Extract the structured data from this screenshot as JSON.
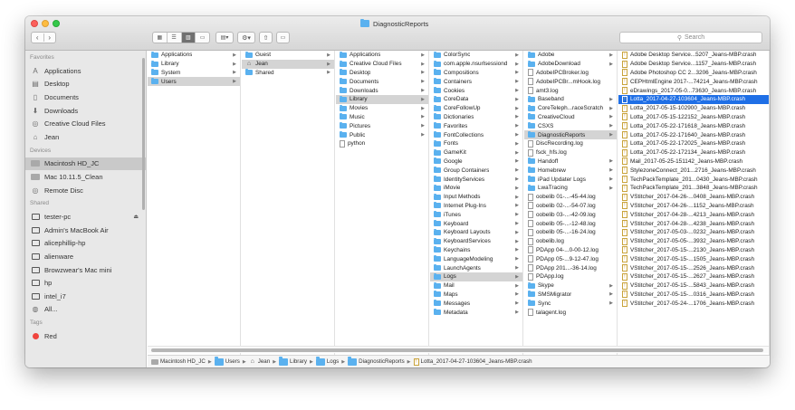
{
  "window": {
    "title": "DiagnosticReports"
  },
  "toolbar": {
    "back": "‹",
    "forward": "›",
    "search_placeholder": "Search",
    "views": [
      "icon-view",
      "list-view",
      "column-view",
      "cover-flow-view"
    ]
  },
  "sidebar": {
    "favorites_header": "Favorites",
    "favorites": [
      {
        "label": "Applications",
        "icon": "applications-icon"
      },
      {
        "label": "Desktop",
        "icon": "desktop-icon"
      },
      {
        "label": "Documents",
        "icon": "documents-icon"
      },
      {
        "label": "Downloads",
        "icon": "downloads-icon"
      },
      {
        "label": "Creative Cloud Files",
        "icon": "creative-cloud-icon"
      },
      {
        "label": "Jean",
        "icon": "home-icon"
      }
    ],
    "devices_header": "Devices",
    "devices": [
      {
        "label": "Macintosh HD_JC",
        "selected": true
      },
      {
        "label": "Mac 10.11.5_Clean"
      },
      {
        "label": "Remote Disc"
      }
    ],
    "shared_header": "Shared",
    "shared": [
      {
        "label": "tester-pc",
        "eject": "⏏"
      },
      {
        "label": "Admin's MacBook Air"
      },
      {
        "label": "alicephillip-hp"
      },
      {
        "label": "alienware"
      },
      {
        "label": "Browzwear's Mac mini"
      },
      {
        "label": "hp"
      },
      {
        "label": "intel_i7"
      },
      {
        "label": "All..."
      }
    ],
    "tags_header": "Tags",
    "tags": [
      {
        "label": "Red",
        "color": "#f0443d"
      }
    ]
  },
  "columns": [
    [
      {
        "label": "Applications",
        "icon": "folder",
        "arrow": true
      },
      {
        "label": "Library",
        "icon": "folder",
        "arrow": true
      },
      {
        "label": "System",
        "icon": "folder",
        "arrow": true
      },
      {
        "label": "Users",
        "icon": "folder",
        "arrow": true,
        "state": "hl"
      }
    ],
    [
      {
        "label": "Guest",
        "icon": "folder",
        "arrow": true
      },
      {
        "label": "Jean",
        "icon": "home",
        "arrow": true,
        "state": "hl"
      },
      {
        "label": "Shared",
        "icon": "folder",
        "arrow": true
      }
    ],
    [
      {
        "label": "Applications",
        "icon": "folder",
        "arrow": true
      },
      {
        "label": "Creative Cloud Files",
        "icon": "folder",
        "arrow": true
      },
      {
        "label": "Desktop",
        "icon": "folder",
        "arrow": true
      },
      {
        "label": "Documents",
        "icon": "folder",
        "arrow": true
      },
      {
        "label": "Downloads",
        "icon": "folder",
        "arrow": true
      },
      {
        "label": "Library",
        "icon": "folder",
        "arrow": true,
        "state": "hl"
      },
      {
        "label": "Movies",
        "icon": "folder",
        "arrow": true
      },
      {
        "label": "Music",
        "icon": "folder",
        "arrow": true
      },
      {
        "label": "Pictures",
        "icon": "folder",
        "arrow": true
      },
      {
        "label": "Public",
        "icon": "folder",
        "arrow": true
      },
      {
        "label": "python",
        "icon": "doc",
        "arrow": false
      }
    ],
    [
      {
        "label": "ColorSync",
        "icon": "folder",
        "arrow": true
      },
      {
        "label": "com.apple.nsurlsessiond",
        "icon": "folder",
        "arrow": true
      },
      {
        "label": "Compositions",
        "icon": "folder",
        "arrow": true
      },
      {
        "label": "Containers",
        "icon": "folder",
        "arrow": true
      },
      {
        "label": "Cookies",
        "icon": "folder",
        "arrow": true
      },
      {
        "label": "CoreData",
        "icon": "folder",
        "arrow": true
      },
      {
        "label": "CoreFollowUp",
        "icon": "folder",
        "arrow": true
      },
      {
        "label": "Dictionaries",
        "icon": "folder",
        "arrow": true
      },
      {
        "label": "Favorites",
        "icon": "folder",
        "arrow": true
      },
      {
        "label": "FontCollections",
        "icon": "folder",
        "arrow": true
      },
      {
        "label": "Fonts",
        "icon": "folder",
        "arrow": true
      },
      {
        "label": "GameKit",
        "icon": "folder",
        "arrow": true
      },
      {
        "label": "Google",
        "icon": "folder",
        "arrow": true
      },
      {
        "label": "Group Containers",
        "icon": "folder",
        "arrow": true
      },
      {
        "label": "IdentityServices",
        "icon": "folder",
        "arrow": true
      },
      {
        "label": "iMovie",
        "icon": "folder",
        "arrow": true
      },
      {
        "label": "Input Methods",
        "icon": "folder",
        "arrow": true
      },
      {
        "label": "Internet Plug-Ins",
        "icon": "folder",
        "arrow": true
      },
      {
        "label": "iTunes",
        "icon": "folder",
        "arrow": true
      },
      {
        "label": "Keyboard",
        "icon": "folder",
        "arrow": true
      },
      {
        "label": "Keyboard Layouts",
        "icon": "folder",
        "arrow": true
      },
      {
        "label": "KeyboardServices",
        "icon": "folder",
        "arrow": true
      },
      {
        "label": "Keychains",
        "icon": "folder",
        "arrow": true
      },
      {
        "label": "LanguageModeling",
        "icon": "folder",
        "arrow": true
      },
      {
        "label": "LaunchAgents",
        "icon": "folder",
        "arrow": true
      },
      {
        "label": "Logs",
        "icon": "folder",
        "arrow": true,
        "state": "hl"
      },
      {
        "label": "Mail",
        "icon": "folder",
        "arrow": true
      },
      {
        "label": "Maps",
        "icon": "folder",
        "arrow": true
      },
      {
        "label": "Messages",
        "icon": "folder",
        "arrow": true
      },
      {
        "label": "Metadata",
        "icon": "folder",
        "arrow": true
      }
    ],
    [
      {
        "label": "Adobe",
        "icon": "folder",
        "arrow": true
      },
      {
        "label": "AdobeDownload",
        "icon": "folder",
        "arrow": true
      },
      {
        "label": "AdobeIPCBroker.log",
        "icon": "doc",
        "arrow": false
      },
      {
        "label": "AdobeIPCBr...mHook.log",
        "icon": "doc",
        "arrow": false
      },
      {
        "label": "amt3.log",
        "icon": "doc",
        "arrow": false
      },
      {
        "label": "Baseband",
        "icon": "folder",
        "arrow": true
      },
      {
        "label": "CoreTeleph...raceScratch",
        "icon": "folder",
        "arrow": true
      },
      {
        "label": "CreativeCloud",
        "icon": "folder",
        "arrow": true
      },
      {
        "label": "CSXS",
        "icon": "folder",
        "arrow": true
      },
      {
        "label": "DiagnosticReports",
        "icon": "folder",
        "arrow": true,
        "state": "hl"
      },
      {
        "label": "DiscRecording.log",
        "icon": "doc",
        "arrow": false
      },
      {
        "label": "fsck_hfs.log",
        "icon": "doc",
        "arrow": false
      },
      {
        "label": "Handoff",
        "icon": "folder",
        "arrow": true
      },
      {
        "label": "Homebrew",
        "icon": "folder",
        "arrow": true
      },
      {
        "label": "iPad Updater Logs",
        "icon": "folder",
        "arrow": true
      },
      {
        "label": "LwaTracing",
        "icon": "folder",
        "arrow": true
      },
      {
        "label": "oobelib 01-...-45-44.log",
        "icon": "doc",
        "arrow": false
      },
      {
        "label": "oobelib 02-...-54-07.log",
        "icon": "doc",
        "arrow": false
      },
      {
        "label": "oobelib 03-...-42-09.log",
        "icon": "doc",
        "arrow": false
      },
      {
        "label": "oobelib 05-...-12-48.log",
        "icon": "doc",
        "arrow": false
      },
      {
        "label": "oobelib 05-...-16-24.log",
        "icon": "doc",
        "arrow": false
      },
      {
        "label": "oobelib.log",
        "icon": "doc",
        "arrow": false
      },
      {
        "label": "PDApp 04-...0-00-12.log",
        "icon": "doc",
        "arrow": false
      },
      {
        "label": "PDApp 05-...9-12-47.log",
        "icon": "doc",
        "arrow": false
      },
      {
        "label": "PDApp 201...-36-14.log",
        "icon": "doc",
        "arrow": false
      },
      {
        "label": "PDApp.log",
        "icon": "doc",
        "arrow": false
      },
      {
        "label": "Skype",
        "icon": "folder",
        "arrow": true
      },
      {
        "label": "SMSMigrator",
        "icon": "folder",
        "arrow": true
      },
      {
        "label": "Sync",
        "icon": "folder",
        "arrow": true
      },
      {
        "label": "talagent.log",
        "icon": "doc",
        "arrow": false
      }
    ],
    [
      {
        "label": "Adobe Desktop Service...5207_Jeans-MBP.crash",
        "icon": "crash"
      },
      {
        "label": "Adobe Desktop Service...1157_Jeans-MBP.crash",
        "icon": "crash"
      },
      {
        "label": "Adobe Photoshop CC 2...3206_Jeans-MBP.crash",
        "icon": "crash"
      },
      {
        "label": "CEPHtmlEngine 2017-...74214_Jeans-MBP.crash",
        "icon": "crash"
      },
      {
        "label": "eDrawings_2017-05-0...73630_Jeans-MBP.crash",
        "icon": "crash"
      },
      {
        "label": "Lotta_2017-04-27-103604_Jeans-MBP.crash",
        "icon": "crash",
        "state": "sel"
      },
      {
        "label": "Lotta_2017-05-15-102900_Jeans-MBP.crash",
        "icon": "crash"
      },
      {
        "label": "Lotta_2017-05-15-122152_Jeans-MBP.crash",
        "icon": "crash"
      },
      {
        "label": "Lotta_2017-05-22-171618_Jeans-MBP.crash",
        "icon": "crash"
      },
      {
        "label": "Lotta_2017-05-22-171640_Jeans-MBP.crash",
        "icon": "crash"
      },
      {
        "label": "Lotta_2017-05-22-172025_Jeans-MBP.crash",
        "icon": "crash"
      },
      {
        "label": "Lotta_2017-05-22-172134_Jeans-MBP.crash",
        "icon": "crash"
      },
      {
        "label": "Mail_2017-05-25-151142_Jeans-MBP.crash",
        "icon": "crash"
      },
      {
        "label": "StylezoneConnect_201...2716_Jeans-MBP.crash",
        "icon": "crash"
      },
      {
        "label": "TechPackTemplate_201...0430_Jeans-MBP.crash",
        "icon": "crash"
      },
      {
        "label": "TechPackTemplate_201...3848_Jeans-MBP.crash",
        "icon": "crash"
      },
      {
        "label": "VStitcher_2017-04-26-...0408_Jeans-MBP.crash",
        "icon": "crash"
      },
      {
        "label": "VStitcher_2017-04-26-...1152_Jeans-MBP.crash",
        "icon": "crash"
      },
      {
        "label": "VStitcher_2017-04-28-...4213_Jeans-MBP.crash",
        "icon": "crash"
      },
      {
        "label": "VStitcher_2017-04-28-...4238_Jeans-MBP.crash",
        "icon": "crash"
      },
      {
        "label": "VStitcher_2017-05-03-...0232_Jeans-MBP.crash",
        "icon": "crash"
      },
      {
        "label": "VStitcher_2017-05-05-...3932_Jeans-MBP.crash",
        "icon": "crash"
      },
      {
        "label": "VStitcher_2017-05-15-...2130_Jeans-MBP.crash",
        "icon": "crash"
      },
      {
        "label": "VStitcher_2017-05-15-...1505_Jeans-MBP.crash",
        "icon": "crash"
      },
      {
        "label": "VStitcher_2017-05-15-...2526_Jeans-MBP.crash",
        "icon": "crash"
      },
      {
        "label": "VStitcher_2017-05-15-...2627_Jeans-MBP.crash",
        "icon": "crash"
      },
      {
        "label": "VStitcher_2017-05-15-...5843_Jeans-MBP.crash",
        "icon": "crash"
      },
      {
        "label": "VStitcher_2017-05-15-...0316_Jeans-MBP.crash",
        "icon": "crash"
      },
      {
        "label": "VStitcher_2017-05-24-...1706_Jeans-MBP.crash",
        "icon": "crash"
      }
    ]
  ],
  "pathbar": [
    {
      "label": "Macintosh HD_JC",
      "icon": "disk"
    },
    {
      "label": "Users",
      "icon": "folder"
    },
    {
      "label": "Jean",
      "icon": "home"
    },
    {
      "label": "Library",
      "icon": "folder"
    },
    {
      "label": "Logs",
      "icon": "folder"
    },
    {
      "label": "DiagnosticReports",
      "icon": "folder"
    },
    {
      "label": "Lotta_2017-04-27-103604_Jeans-MBP.crash",
      "icon": "crash"
    }
  ],
  "colors": {
    "selection": "#1f6fe6",
    "folder": "#5ab1ef",
    "tag_red": "#f0443d"
  }
}
